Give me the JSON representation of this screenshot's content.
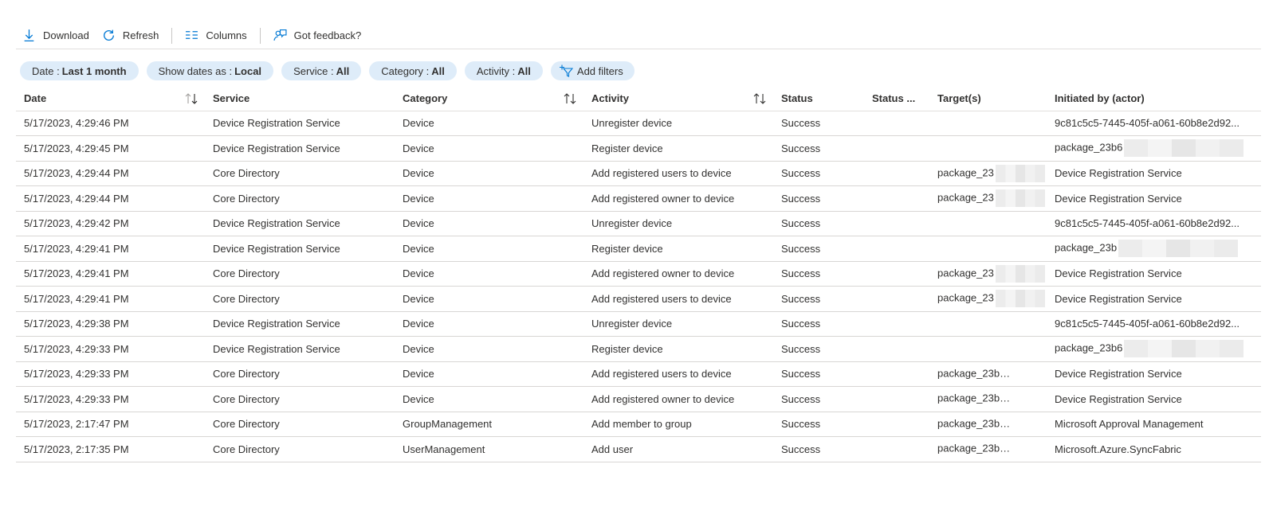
{
  "toolbar": {
    "download": "Download",
    "refresh": "Refresh",
    "columns": "Columns",
    "feedback": "Got feedback?"
  },
  "filters": [
    {
      "key": "Date :",
      "value": "Last 1 month"
    },
    {
      "key": "Show dates as :",
      "value": "Local"
    },
    {
      "key": "Service :",
      "value": "All"
    },
    {
      "key": "Category :",
      "value": "All"
    },
    {
      "key": "Activity :",
      "value": "All"
    }
  ],
  "add_filters": "Add filters",
  "columns": [
    "Date",
    "Service",
    "Category",
    "Activity",
    "Status",
    "Status ...",
    "Target(s)",
    "Initiated by (actor)"
  ],
  "rows": [
    {
      "date": "5/17/2023, 4:29:46 PM",
      "service": "Device Registration Service",
      "category": "Device",
      "activity": "Unregister device",
      "status": "Success",
      "reason": "",
      "target": "",
      "actor": "9c81c5c5-7445-405f-a061-60b8e2d92..."
    },
    {
      "date": "5/17/2023, 4:29:45 PM",
      "service": "Device Registration Service",
      "category": "Device",
      "activity": "Register device",
      "status": "Success",
      "reason": "",
      "target": "",
      "actor": "package_23b6"
    },
    {
      "date": "5/17/2023, 4:29:44 PM",
      "service": "Core Directory",
      "category": "Device",
      "activity": "Add registered users to device",
      "status": "Success",
      "reason": "",
      "target": "package_23",
      "actor": "Device Registration Service"
    },
    {
      "date": "5/17/2023, 4:29:44 PM",
      "service": "Core Directory",
      "category": "Device",
      "activity": "Add registered owner to device",
      "status": "Success",
      "reason": "",
      "target": "package_23",
      "actor": "Device Registration Service"
    },
    {
      "date": "5/17/2023, 4:29:42 PM",
      "service": "Device Registration Service",
      "category": "Device",
      "activity": "Unregister device",
      "status": "Success",
      "reason": "",
      "target": "",
      "actor": "9c81c5c5-7445-405f-a061-60b8e2d92..."
    },
    {
      "date": "5/17/2023, 4:29:41 PM",
      "service": "Device Registration Service",
      "category": "Device",
      "activity": "Register device",
      "status": "Success",
      "reason": "",
      "target": "",
      "actor": "package_23b"
    },
    {
      "date": "5/17/2023, 4:29:41 PM",
      "service": "Core Directory",
      "category": "Device",
      "activity": "Add registered owner to device",
      "status": "Success",
      "reason": "",
      "target": "package_23",
      "actor": "Device Registration Service"
    },
    {
      "date": "5/17/2023, 4:29:41 PM",
      "service": "Core Directory",
      "category": "Device",
      "activity": "Add registered users to device",
      "status": "Success",
      "reason": "",
      "target": "package_23",
      "actor": "Device Registration Service"
    },
    {
      "date": "5/17/2023, 4:29:38 PM",
      "service": "Device Registration Service",
      "category": "Device",
      "activity": "Unregister device",
      "status": "Success",
      "reason": "",
      "target": "",
      "actor": "9c81c5c5-7445-405f-a061-60b8e2d92..."
    },
    {
      "date": "5/17/2023, 4:29:33 PM",
      "service": "Device Registration Service",
      "category": "Device",
      "activity": "Register device",
      "status": "Success",
      "reason": "",
      "target": "",
      "actor": "package_23b6"
    },
    {
      "date": "5/17/2023, 4:29:33 PM",
      "service": "Core Directory",
      "category": "Device",
      "activity": "Add registered users to device",
      "status": "Success",
      "reason": "",
      "target": "package_23b",
      "actor": "Device Registration Service"
    },
    {
      "date": "5/17/2023, 4:29:33 PM",
      "service": "Core Directory",
      "category": "Device",
      "activity": "Add registered owner to device",
      "status": "Success",
      "reason": "",
      "target": "package_23b",
      "actor": "Device Registration Service"
    },
    {
      "date": "5/17/2023, 2:17:47 PM",
      "service": "Core Directory",
      "category": "GroupManagement",
      "activity": "Add member to group",
      "status": "Success",
      "reason": "",
      "target": "package_23b",
      "actor": "Microsoft Approval Management"
    },
    {
      "date": "5/17/2023, 2:17:35 PM",
      "service": "Core Directory",
      "category": "UserManagement",
      "activity": "Add user",
      "status": "Success",
      "reason": "",
      "target": "package_23b",
      "actor": "Microsoft.Azure.SyncFabric"
    }
  ],
  "colors": {
    "accent": "#0078d4",
    "pill_bg": "#deecf9",
    "text": "#323130",
    "divider": "#e1dfdd"
  },
  "icons": [
    "download-icon",
    "refresh-icon",
    "columns-icon",
    "feedback-icon",
    "add-filter-icon",
    "sort-icon"
  ]
}
